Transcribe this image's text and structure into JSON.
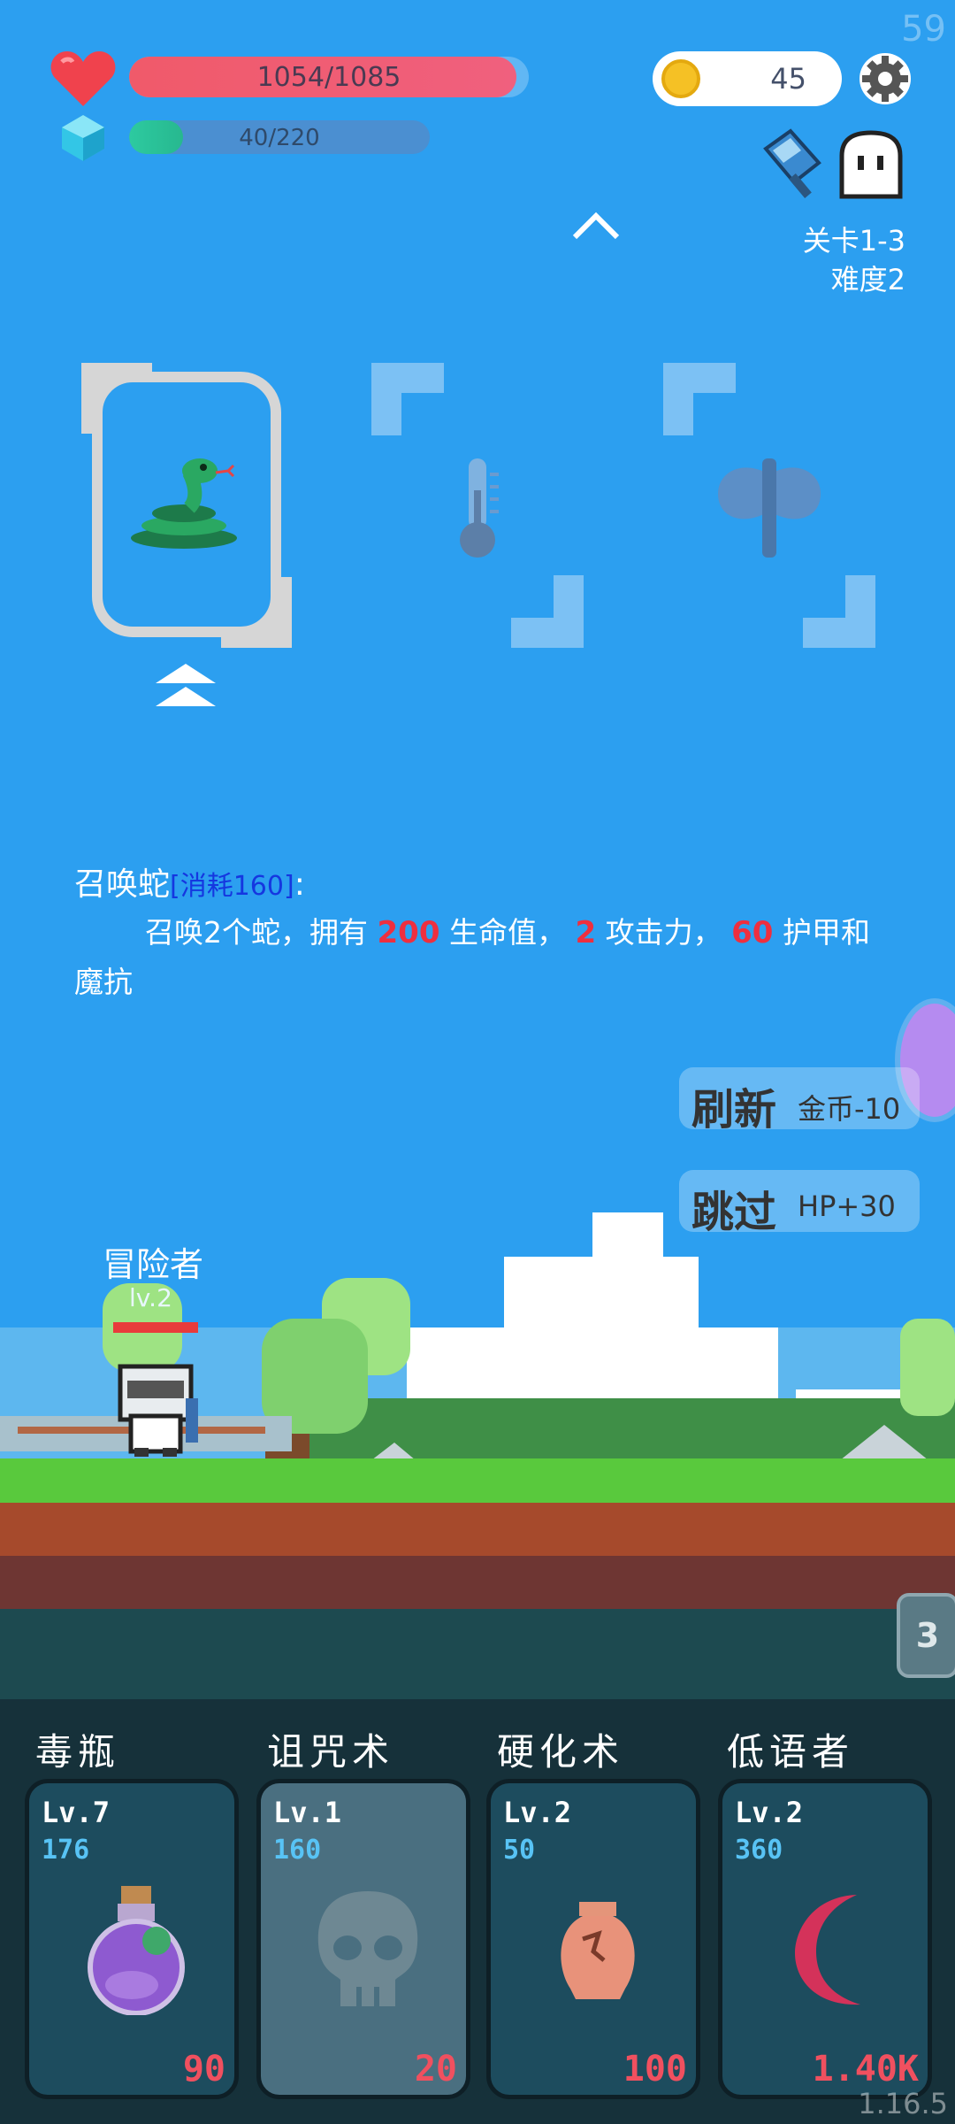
{
  "hud": {
    "fps": "59",
    "hp_text": "1054/1085",
    "hp_fraction": 0.97,
    "mp_text": "40/220",
    "mp_fraction": 0.18,
    "coins": "45",
    "icons": [
      "heart-icon",
      "crystal-icon",
      "coin-icon",
      "gear-icon",
      "cleaver-icon",
      "ghost-icon",
      "chevron-up-icon"
    ]
  },
  "stage": {
    "level": "关卡1-3",
    "difficulty": "难度2"
  },
  "choices": [
    {
      "name": "snake-icon",
      "selected": true
    },
    {
      "name": "thermometer-icon",
      "selected": false
    },
    {
      "name": "battle-axe-icon",
      "selected": false
    }
  ],
  "description": {
    "title": "召唤蛇",
    "cost": "[消耗160]",
    "colon": ":",
    "p1": "召唤2个蛇，拥有 ",
    "hp": "200",
    "p2": " 生命值， ",
    "atk": "2",
    "p3": " 攻击力， ",
    "armor": "60",
    "p4": " 护甲和魔抗"
  },
  "buttons": {
    "refresh_main": "刷新",
    "refresh_sub": "金币-10",
    "skip_main": "跳过",
    "skip_sub": "HP+30"
  },
  "hero": {
    "name": "冒险者",
    "level": "lv.2"
  },
  "queue_count": "3",
  "skills": [
    {
      "name": "毒瓶",
      "lv": "Lv.7",
      "cost": "176",
      "price": "90",
      "icon": "poison-bottle-icon",
      "dim": false
    },
    {
      "name": "诅咒术",
      "lv": "Lv.1",
      "cost": "160",
      "price": "20",
      "icon": "skull-icon",
      "dim": true
    },
    {
      "name": "硬化术",
      "lv": "Lv.2",
      "cost": "50",
      "price": "100",
      "icon": "vase-icon",
      "dim": false
    },
    {
      "name": "低语者",
      "lv": "Lv.2",
      "cost": "360",
      "price": "1.40K",
      "icon": "crescent-icon",
      "dim": false
    }
  ],
  "version": "1.16.5"
}
